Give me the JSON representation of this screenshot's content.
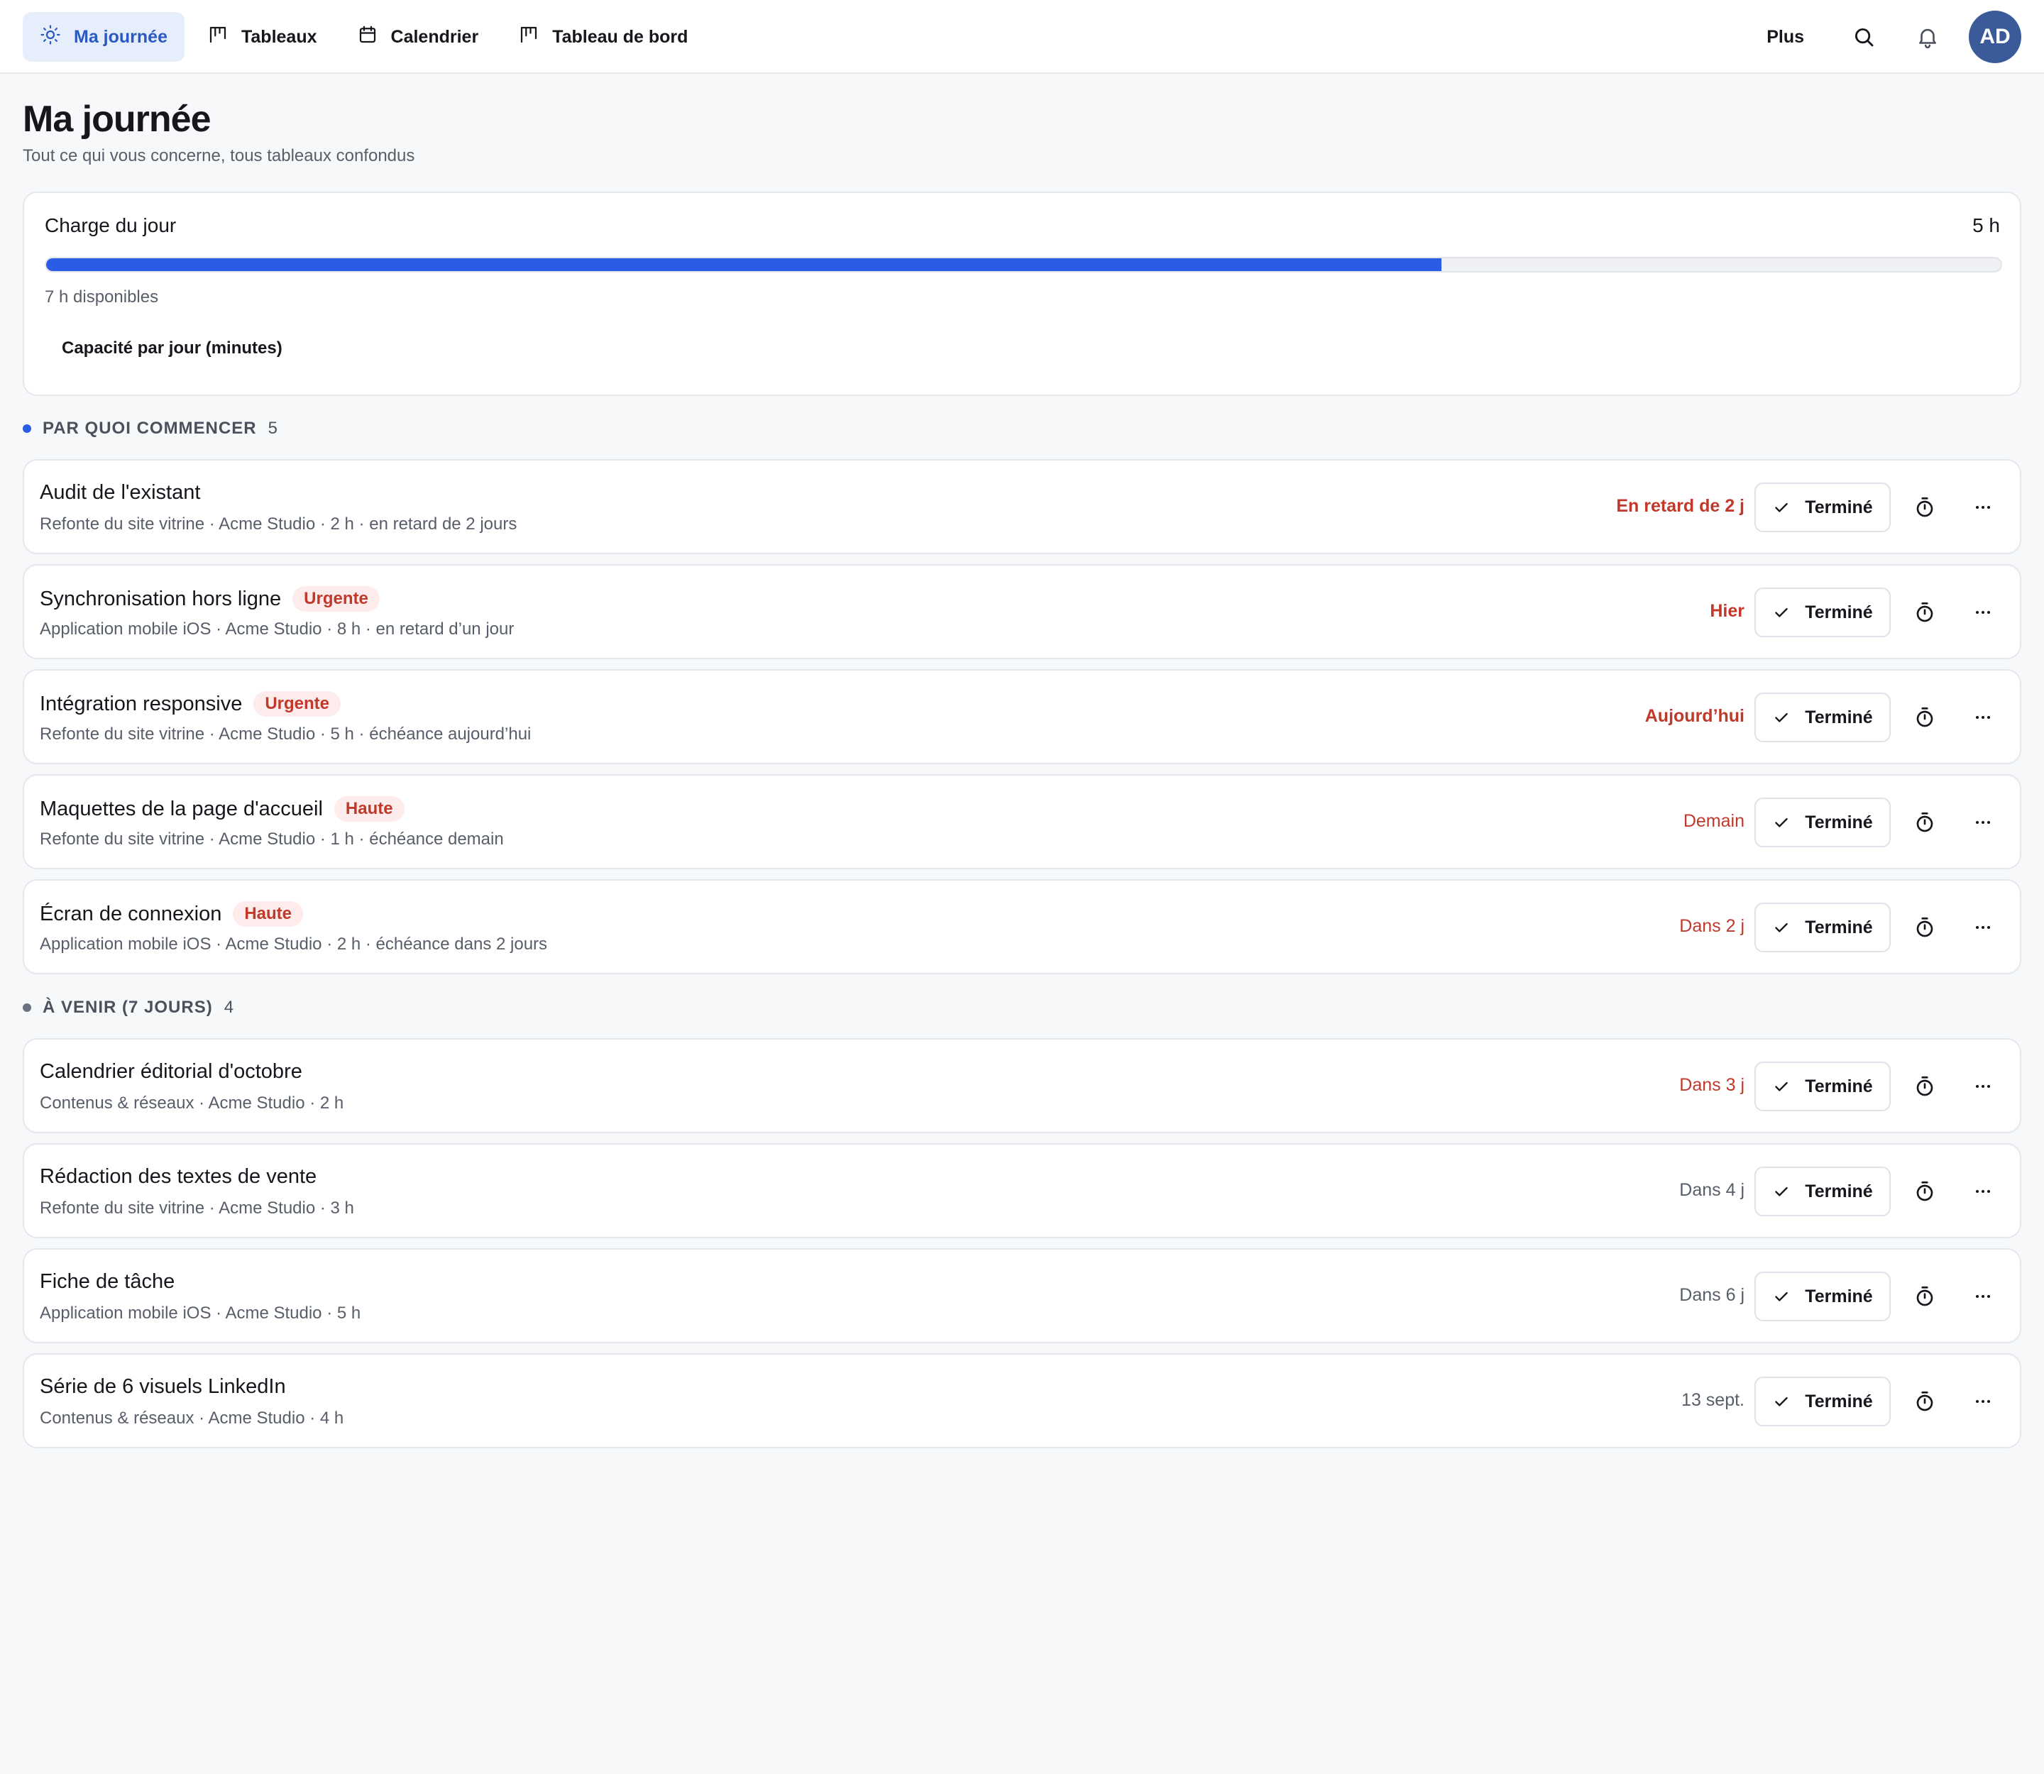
{
  "nav": {
    "items": [
      {
        "label": "Ma journée",
        "icon": "sun-icon",
        "active": true
      },
      {
        "label": "Tableaux",
        "icon": "kanban-icon",
        "active": false
      },
      {
        "label": "Calendrier",
        "icon": "calendar-icon",
        "active": false
      },
      {
        "label": "Tableau de bord",
        "icon": "kanban-icon",
        "active": false
      }
    ],
    "more_label": "Plus",
    "avatar_initials": "AD"
  },
  "page": {
    "title": "Ma journée",
    "subtitle": "Tout ce qui vous concerne, tous tableaux confondus"
  },
  "load": {
    "title": "Charge du jour",
    "total": "5 h",
    "available": "7 h disponibles",
    "capacity_label": "Capacité par jour (minutes)",
    "fill_fraction": 0.714,
    "bar_color": "#2b5ce6"
  },
  "sections": [
    {
      "label": "PAR QUOI COMMENCER",
      "count": "5",
      "dot_color": "#2b5ce6",
      "tasks": [
        {
          "title": "Audit de l'existant",
          "badge": "",
          "meta": "Refonte du site vitrine · Acme Studio · 2 h · en retard de 2 jours",
          "due": "En retard de 2 j",
          "due_style": "late",
          "done_label": "Terminé"
        },
        {
          "title": "Synchronisation hors ligne",
          "badge": "Urgente",
          "meta": "Application mobile iOS · Acme Studio · 8 h · en retard d’un jour",
          "due": "Hier",
          "due_style": "late",
          "done_label": "Terminé"
        },
        {
          "title": "Intégration responsive",
          "badge": "Urgente",
          "meta": "Refonte du site vitrine · Acme Studio · 5 h · échéance aujourd’hui",
          "due": "Aujourd’hui",
          "due_style": "late",
          "done_label": "Terminé"
        },
        {
          "title": "Maquettes de la page d'accueil",
          "badge": "Haute",
          "meta": "Refonte du site vitrine · Acme Studio · 1 h · échéance demain",
          "due": "Demain",
          "due_style": "red",
          "done_label": "Terminé"
        },
        {
          "title": "Écran de connexion",
          "badge": "Haute",
          "meta": "Application mobile iOS · Acme Studio · 2 h · échéance dans 2 jours",
          "due": "Dans 2 j",
          "due_style": "red",
          "done_label": "Terminé"
        }
      ]
    },
    {
      "label": "À VENIR (7 JOURS)",
      "count": "4",
      "dot_color": "#6b7280",
      "tasks": [
        {
          "title": "Calendrier éditorial d'octobre",
          "badge": "",
          "meta": "Contenus & réseaux · Acme Studio · 2 h",
          "due": "Dans 3 j",
          "due_style": "red",
          "done_label": "Terminé"
        },
        {
          "title": "Rédaction des textes de vente",
          "badge": "",
          "meta": "Refonte du site vitrine · Acme Studio · 3 h",
          "due": "Dans 4 j",
          "due_style": "gray",
          "done_label": "Terminé"
        },
        {
          "title": "Fiche de tâche",
          "badge": "",
          "meta": "Application mobile iOS · Acme Studio · 5 h",
          "due": "Dans 6 j",
          "due_style": "gray",
          "done_label": "Terminé"
        },
        {
          "title": "Série de 6 visuels LinkedIn",
          "badge": "",
          "meta": "Contenus & réseaux · Acme Studio · 4 h",
          "due": "13 sept.",
          "due_style": "gray",
          "done_label": "Terminé"
        }
      ]
    }
  ]
}
